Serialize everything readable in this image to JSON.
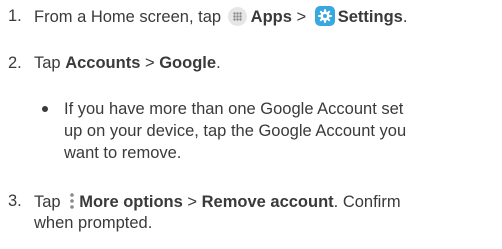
{
  "steps": [
    {
      "number": "1.",
      "text_from": "From a Home screen, tap",
      "apps_label": "Apps",
      "separator": ">",
      "settings_label": "Settings",
      "end": "."
    },
    {
      "number": "2.",
      "text_tap": "Tap",
      "accounts_label": "Accounts",
      "separator": ">",
      "google_label": "Google",
      "end": "."
    },
    {
      "number": "3.",
      "text_tap": "Tap",
      "more_options_label": "More options",
      "separator": ">",
      "remove_account_label": "Remove account",
      "end_line1": ". Confirm",
      "line2": "when prompted."
    }
  ],
  "bullet": {
    "line1": "If you have more than one Google Account set",
    "line2": "up on your device, tap the Google Account you",
    "line3": "want to remove."
  },
  "icons": {
    "apps": "apps-grid-icon",
    "settings": "settings-gear-icon",
    "more_options": "vertical-dots-icon"
  },
  "colors": {
    "text": "#3a3a3a",
    "settings_icon_bg": "#3aa8e0",
    "apps_icon_bg": "#e6e6e6"
  }
}
